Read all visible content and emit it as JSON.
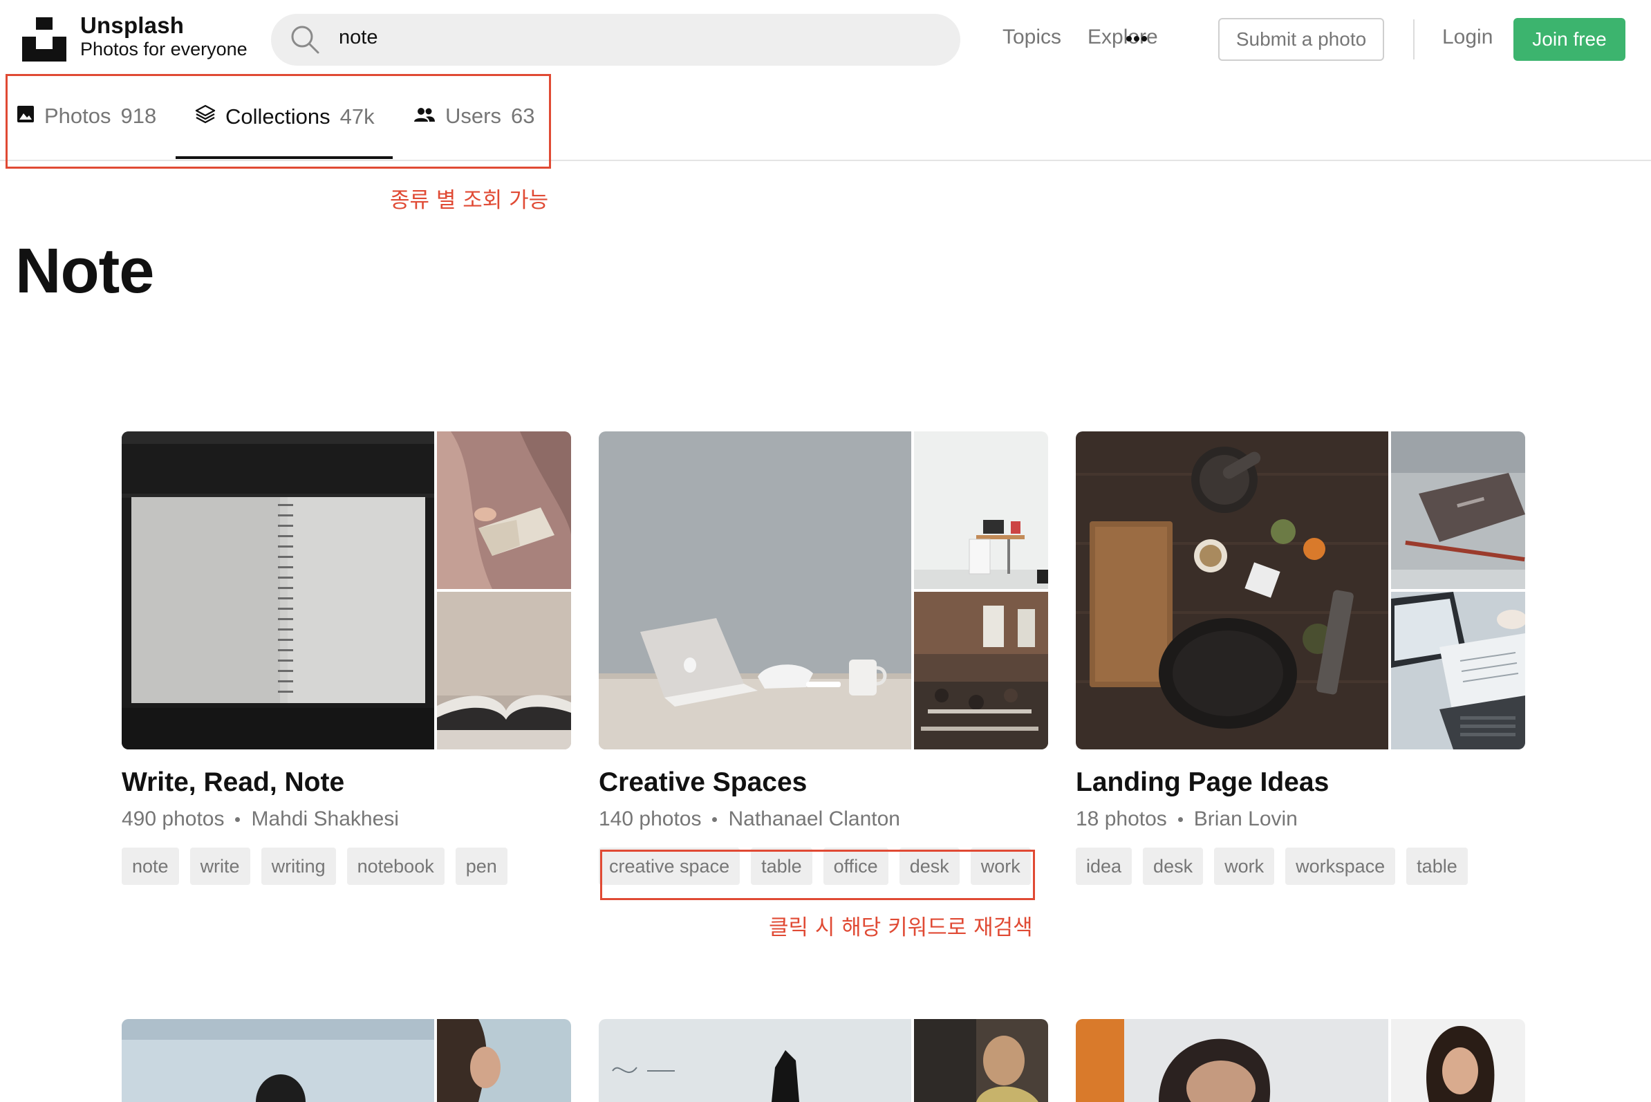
{
  "brand": {
    "name": "Unsplash",
    "tagline": "Photos for everyone"
  },
  "search": {
    "value": "note"
  },
  "nav": {
    "topics": "Topics",
    "explore": "Explore",
    "submit": "Submit a photo",
    "login": "Login",
    "join": "Join free"
  },
  "tabs": [
    {
      "label": "Photos",
      "count": "918",
      "active": false
    },
    {
      "label": "Collections",
      "count": "47k",
      "active": true
    },
    {
      "label": "Users",
      "count": "63",
      "active": false
    }
  ],
  "annotations": {
    "tabs_note": "종류 별 조회 가능",
    "tags_note": "클릭 시 해당 키워드로 재검색"
  },
  "page_title": "Note",
  "collections": [
    {
      "title": "Write, Read, Note",
      "photos": "490 photos",
      "author": "Mahdi Shakhesi",
      "tags": [
        "note",
        "write",
        "writing",
        "notebook",
        "pen"
      ]
    },
    {
      "title": "Creative Spaces",
      "photos": "140 photos",
      "author": "Nathanael Clanton",
      "tags": [
        "creative space",
        "table",
        "office",
        "desk",
        "work"
      ]
    },
    {
      "title": "Landing Page Ideas",
      "photos": "18 photos",
      "author": "Brian Lovin",
      "tags": [
        "idea",
        "desk",
        "work",
        "workspace",
        "table"
      ]
    }
  ],
  "colors": {
    "accent_green": "#3cb46e",
    "annotation_red": "#e04a34",
    "muted_text": "#767676"
  }
}
